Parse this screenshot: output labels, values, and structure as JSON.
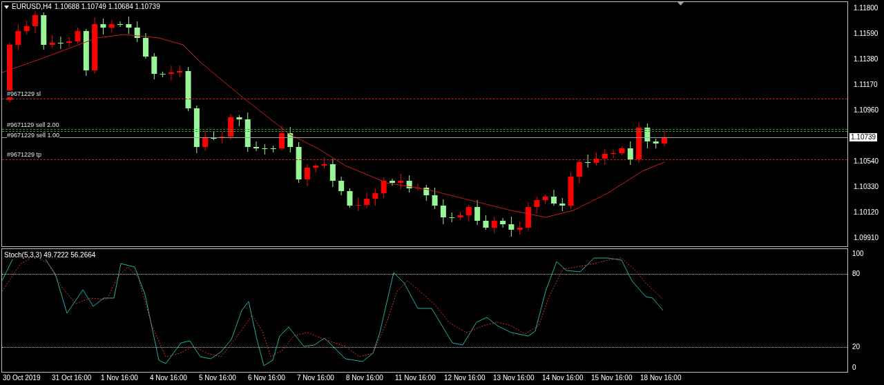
{
  "chart_header": {
    "symbol": "EURUSD,H4",
    "quote": "1.10688 1.10749 1.10684 1.10739"
  },
  "order_lines": [
    {
      "kind": "sl",
      "label": "#9671229 sl",
      "color": "#c81e1e"
    },
    {
      "kind": "entry",
      "label": "#9671129 sell 2.00",
      "color": "#2f9e2f"
    },
    {
      "kind": "entry",
      "label": "#9671229 sell 1.00",
      "color": "#2f9e2f"
    },
    {
      "kind": "tp",
      "label": "#9671229 tp",
      "color": "#c81e1e"
    }
  ],
  "price_axis": {
    "ticks": [
      "1.11800",
      "1.11590",
      "1.11380",
      "1.11170",
      "1.10960",
      "1.10540",
      "1.10330",
      "1.10120",
      "1.09910"
    ],
    "current_price": "1.10739"
  },
  "indicator": {
    "title": "Stoch(5,3,3) 49.7222 56.2664",
    "levels": [
      "100",
      "80",
      "20",
      "0"
    ]
  },
  "time_axis": [
    "30 Oct 2019",
    "31 Oct 16:00",
    "1 Nov 16:00",
    "4 Nov 16:00",
    "5 Nov 16:00",
    "6 Nov 16:00",
    "7 Nov 16:00",
    "8 Nov 16:00",
    "11 Nov 16:00",
    "12 Nov 16:00",
    "13 Nov 16:00",
    "14 Nov 16:00",
    "15 Nov 16:00",
    "18 Nov 16:00"
  ]
}
